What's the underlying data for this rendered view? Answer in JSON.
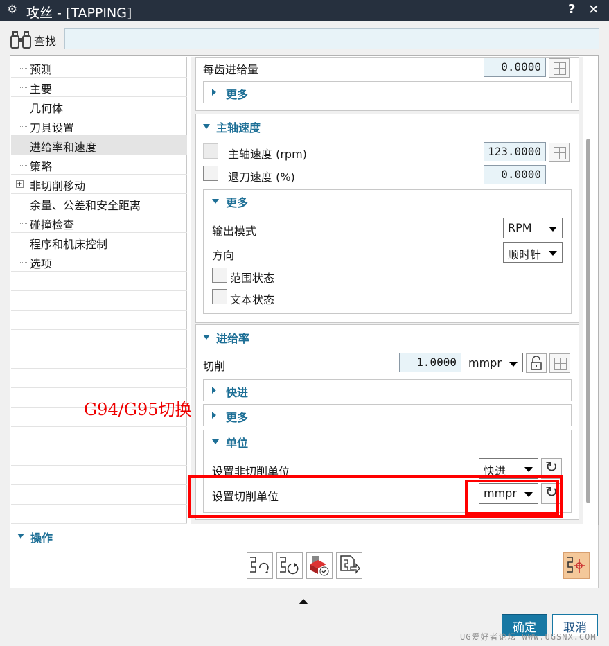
{
  "window": {
    "title": "攻丝 - [TAPPING]",
    "help": "?",
    "close": "✕",
    "gear": "⚙"
  },
  "find": {
    "label": "查找",
    "value": ""
  },
  "tree": {
    "items": [
      {
        "label": "预测",
        "expandable": false,
        "selected": false
      },
      {
        "label": "主要",
        "expandable": false,
        "selected": false
      },
      {
        "label": "几何体",
        "expandable": false,
        "selected": false
      },
      {
        "label": "刀具设置",
        "expandable": false,
        "selected": false
      },
      {
        "label": "进给率和速度",
        "expandable": false,
        "selected": true
      },
      {
        "label": "策略",
        "expandable": false,
        "selected": false
      },
      {
        "label": "非切削移动",
        "expandable": true,
        "selected": false
      },
      {
        "label": "余量、公差和安全距离",
        "expandable": false,
        "selected": false
      },
      {
        "label": "碰撞检查",
        "expandable": false,
        "selected": false
      },
      {
        "label": "程序和机床控制",
        "expandable": false,
        "selected": false
      },
      {
        "label": "选项",
        "expandable": false,
        "selected": false
      }
    ],
    "expander_symbol": "+"
  },
  "feed_per_tooth": {
    "label": "每齿进给量",
    "value": "0.0000",
    "more": "更多"
  },
  "spindle": {
    "header": "主轴速度",
    "speed_label": "主轴速度 (rpm)",
    "speed_value": "123.0000",
    "retract_label": "退刀速度 (%)",
    "retract_value": "0.0000",
    "more": "更多",
    "output_mode_label": "输出模式",
    "output_mode_value": "RPM",
    "direction_label": "方向",
    "direction_value": "顺时针",
    "range_state_label": "范围状态",
    "text_state_label": "文本状态"
  },
  "feed_rate": {
    "header": "进给率",
    "cut_label": "切削",
    "cut_value": "1.0000",
    "cut_unit": "mmpr",
    "rapid": "快进",
    "more": "更多",
    "units_header": "单位",
    "noncut_unit_label": "设置非切削单位",
    "noncut_unit_value": "快进",
    "cut_unit_label": "设置切削单位",
    "cut_unit_value": "mmpr"
  },
  "annotation": "G94/G95切换",
  "operations": {
    "header": "操作"
  },
  "buttons": {
    "ok": "确定",
    "cancel": "取消",
    "reset": "↻"
  },
  "watermark": "UG爱好者论坛 WWW.UGSNX.COM",
  "colors": {
    "accent": "#1d6f96",
    "titlebar": "#26303e",
    "annotation": "#ff0000",
    "ok": "#1778a4"
  }
}
